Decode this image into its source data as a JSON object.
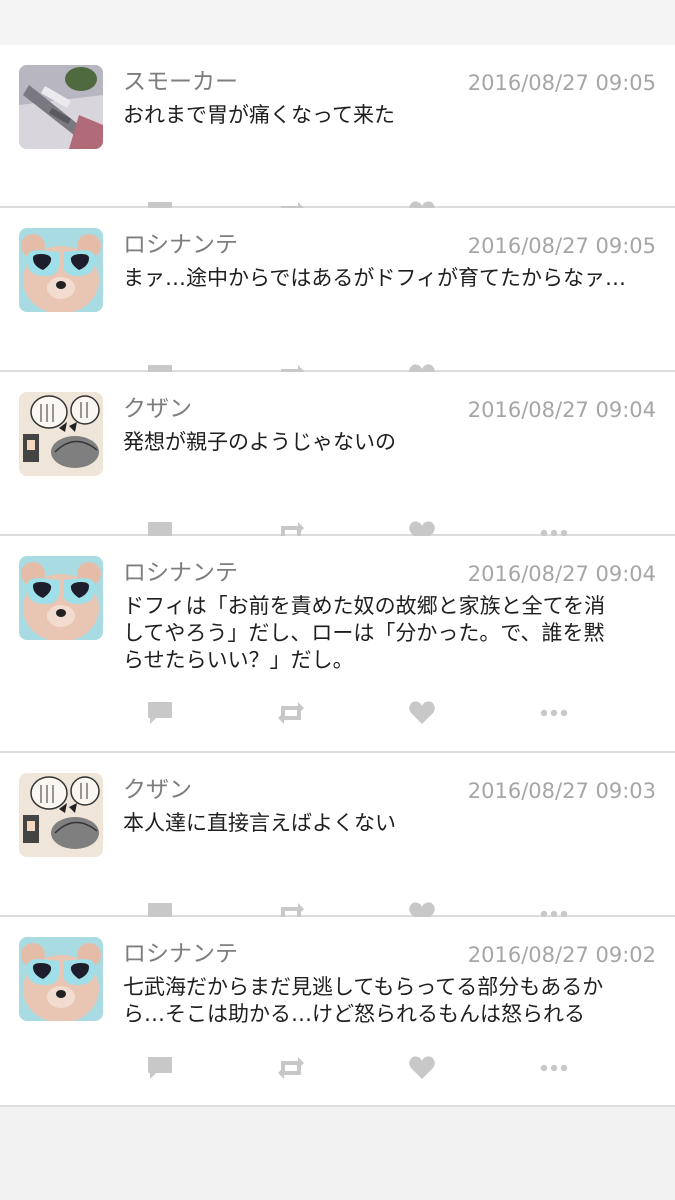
{
  "tweets": [
    {
      "name": "スモーカー",
      "time": "2016/08/27 09:05",
      "text": "おれまで胃が痛くなって来た",
      "avatar": "smoker-avatar"
    },
    {
      "name": "ロシナンテ",
      "time": "2016/08/27 09:05",
      "text": "まァ…途中からではあるがドフィが育てたからなァ…",
      "avatar": "bear-avatar"
    },
    {
      "name": "クザン",
      "time": "2016/08/27 09:04",
      "text": "発想が親子のようじゃないの",
      "avatar": "manga-avatar"
    },
    {
      "name": "ロシナンテ",
      "time": "2016/08/27 09:04",
      "text": "ドフィは「お前を責めた奴の故郷と家族と全てを消\nしてやろう」だし、ローは「分かった。で、誰を黙\nらせたらいい？」だし。",
      "avatar": "bear-avatar"
    },
    {
      "name": "クザン",
      "time": "2016/08/27 09:03",
      "text": "本人達に直接言えばよくない",
      "avatar": "manga-avatar"
    },
    {
      "name": "ロシナンテ",
      "time": "2016/08/27 09:02",
      "text": "七武海だからまだ見逃してもらってる部分もあるか\nら…そこは助かる…けど怒られるもんは怒られる",
      "avatar": "bear-avatar"
    }
  ],
  "colors": {
    "icon": "#c8c8c8",
    "name": "#7d7d7d",
    "time": "#a6a6a6",
    "text": "#1f1f1f",
    "divider": "#dcdcdc"
  },
  "icons": [
    "reply-icon",
    "retweet-icon",
    "like-icon",
    "more-icon"
  ]
}
